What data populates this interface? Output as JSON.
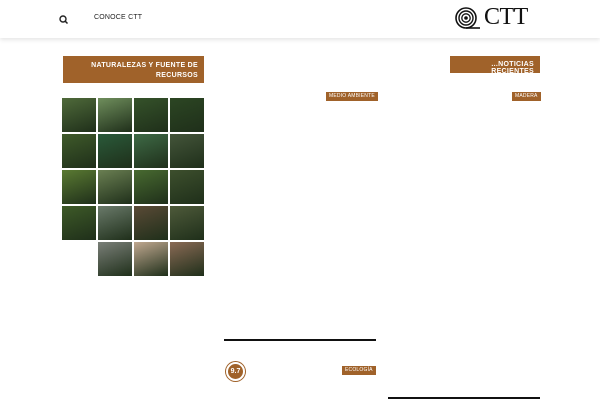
{
  "header": {
    "nav_link": "CONOCE CTT",
    "logo_text": "CTT",
    "search_icon": "search-icon"
  },
  "sidebar_left": {
    "title": "NATURALEZAS Y FUENTE DE RECURSOS"
  },
  "sidebar_right": {
    "title": "...NOTICIAS RECIENTES"
  },
  "tags": {
    "medio_ambiente": "MEDIO AMBIENTE",
    "madera": "MADERA",
    "ecologia": "ECOLOGÍA"
  },
  "score": "9.7",
  "gallery_colors": [
    [
      "#4f6a3a",
      "#6f8e5c",
      "#35522a",
      "#2c4623"
    ],
    [
      "#3f5a2a",
      "#2a5a3a",
      "#3e6a46",
      "#44553a"
    ],
    [
      "#5a7a32",
      "#6a7f52",
      "#486a30",
      "#3d4f2d"
    ],
    [
      "#3e5a28",
      "#6a7a6a",
      "#5a4a36",
      "#4e5a3a"
    ],
    [
      null,
      "#7a7f78",
      "#c0a890",
      "#8a6a55"
    ]
  ],
  "colors": {
    "accent": "#a0622a"
  }
}
